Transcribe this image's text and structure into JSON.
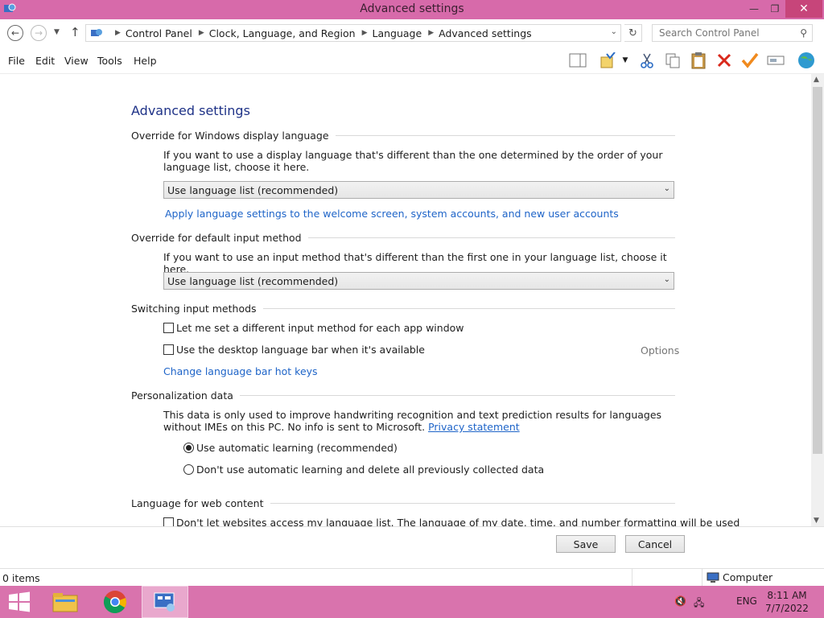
{
  "window": {
    "title": "Advanced settings",
    "min": "—",
    "max": "❐",
    "close": "✕"
  },
  "address": {
    "crumbs": [
      "Control Panel",
      "Clock, Language, and Region",
      "Language",
      "Advanced settings"
    ],
    "search_placeholder": "Search Control Panel"
  },
  "menu": [
    "File",
    "Edit",
    "View",
    "Tools",
    "Help"
  ],
  "page": {
    "heading": "Advanced settings",
    "display_lang": {
      "title": "Override for Windows display language",
      "desc": "If you want to use a display language that's different than the one determined by the order of your language list, choose it here.",
      "select_value": "Use language list (recommended)",
      "apply_link": "Apply language settings to the welcome screen, system accounts, and new user accounts"
    },
    "input_method": {
      "title": "Override for default input method",
      "desc": "If you want to use an input method that's different than the first one in your language list, choose it here.",
      "select_value": "Use language list (recommended)"
    },
    "switching": {
      "title": "Switching input methods",
      "check1": "Let me set a different input method for each app window",
      "check2": "Use the desktop language bar when it's available",
      "options": "Options",
      "hotkeys_link": "Change language bar hot keys"
    },
    "personalization": {
      "title": "Personalization data",
      "desc": "This data is only used to improve handwriting recognition and text prediction results for languages without IMEs on this PC. No info is sent to Microsoft.",
      "privacy_link": "Privacy statement",
      "radio1": "Use automatic learning (recommended)",
      "radio2": "Don't use automatic learning and delete all previously collected data"
    },
    "web_content": {
      "title": "Language for web content",
      "check": "Don't let websites access my language list. The language of my date, time, and number formatting will be used"
    }
  },
  "footer": {
    "save": "Save",
    "cancel": "Cancel"
  },
  "status": {
    "items": "0 items",
    "computer": "Computer"
  },
  "taskbar": {
    "lang": "ENG",
    "time": "8:11 AM",
    "date": "7/7/2022"
  },
  "colors": {
    "titlebar": "#d76aaa",
    "taskbar": "#d973ad",
    "link": "#1e64c8",
    "heading": "#1e3287"
  }
}
